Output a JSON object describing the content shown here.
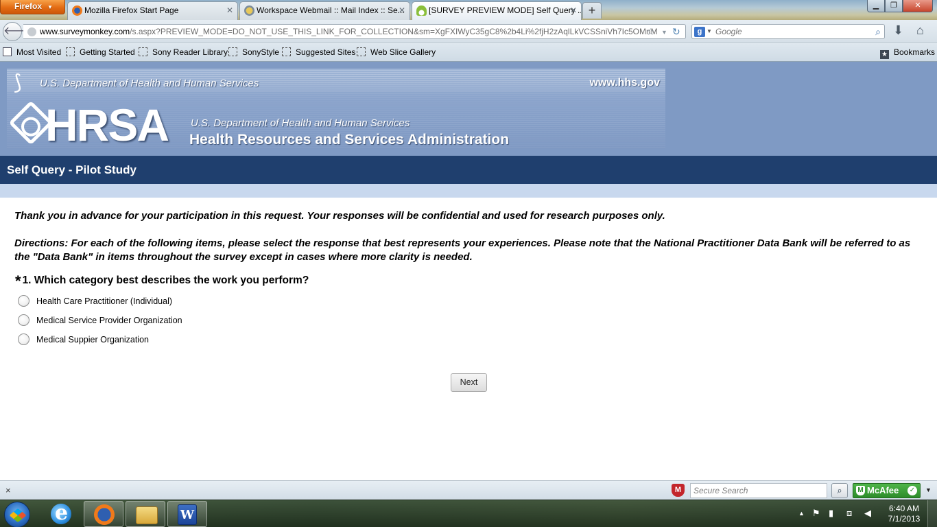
{
  "browser": {
    "menu_button": "Firefox",
    "tabs": [
      {
        "title": "Mozilla Firefox Start Page",
        "active": false
      },
      {
        "title": "Workspace Webmail :: Mail Index :: Se...",
        "active": false
      },
      {
        "title": "[SURVEY PREVIEW MODE] Self Query ...",
        "active": true
      }
    ],
    "new_tab_label": "+",
    "url_host": "www.surveymonkey.com",
    "url_rest": "/s.aspx?PREVIEW_MODE=DO_NOT_USE_THIS_LINK_FOR_COLLECTION&sm=XgFXIWyC35gC8%2b4Li%2fjH2zAqlLkVCSSniVh7Ic5OMnM%3d",
    "search_placeholder": "Google",
    "bookmarks": [
      "Most Visited",
      "Getting Started",
      "Sony Reader Library",
      "SonyStyle",
      "Suggested Sites",
      "Web Slice Gallery"
    ],
    "bookmarks_menu": "Bookmarks"
  },
  "page": {
    "agency_line": "U.S. Department of Health and Human Services",
    "agency_url": "www.hhs.gov",
    "logo_text": "HRSA",
    "agency_sub": "U.S. Department of Health and Human Services",
    "agency_name": "Health Resources and Services Administration",
    "survey_title": "Self Query - Pilot Study",
    "intro": "Thank you in advance for your participation in this request. Your responses will be confidential and used for research purposes only.",
    "directions": "Directions: For each of the following items, please select the response that best represents your experiences. Please note that the National Practitioner Data Bank will be referred to as the \"Data Bank\" in items throughout the survey except in cases where more clarity is needed.",
    "question": {
      "required_mark": "*",
      "text": "1. Which category best describes the work you perform?",
      "options": [
        "Health Care Practitioner (Individual)",
        "Medical Service Provider Organization",
        "Medical Suppier Organization"
      ]
    },
    "next_button": "Next"
  },
  "addon_bar": {
    "close": "×",
    "secure_search_placeholder": "Secure Search",
    "mcafee_label": "McAfee"
  },
  "taskbar": {
    "time": "6:40 AM",
    "date": "7/1/2013"
  },
  "colors": {
    "header_blue": "#7f9ac4",
    "title_bar": "#1f3f6e",
    "firefox_orange": "#e36c14",
    "mcafee_green": "#2d8c2a"
  }
}
